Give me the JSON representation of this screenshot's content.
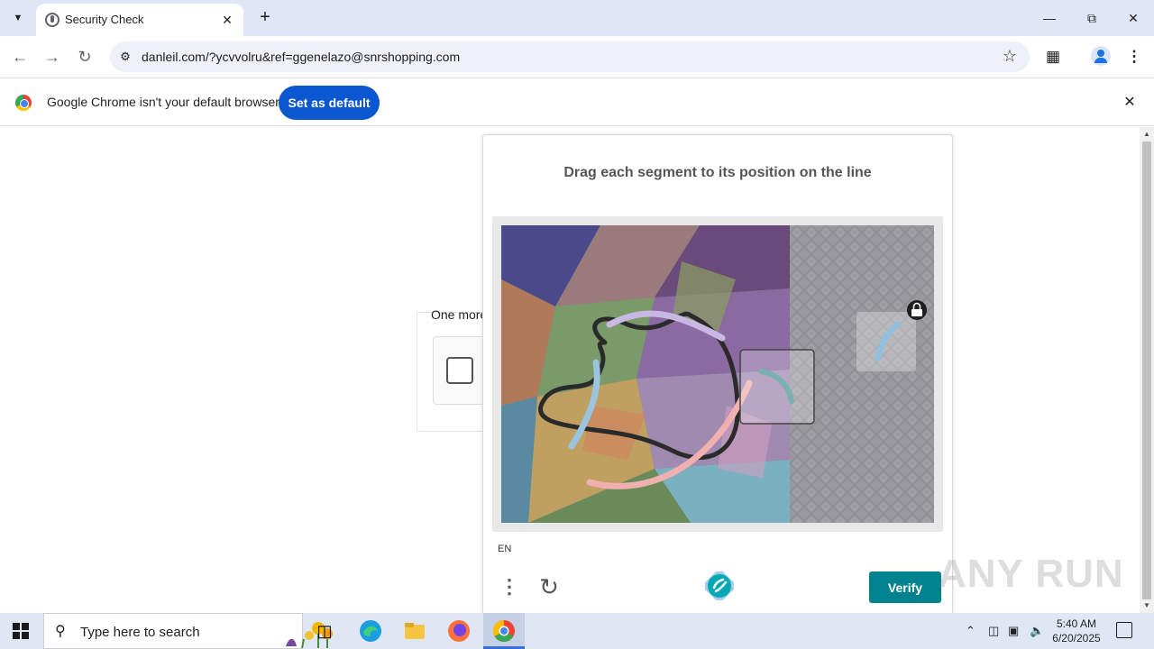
{
  "browser": {
    "tab_title": "Security Check",
    "new_tab_label": "+",
    "url": "danleil.com/?ycvvolru&ref=ggenelazo@snrshopping.com",
    "window_controls": [
      "minimize-icon",
      "restore-icon",
      "close-icon"
    ]
  },
  "infobar": {
    "message": "Google Chrome isn't your default browser",
    "button_label": "Set as default"
  },
  "page": {
    "background_text": "One more"
  },
  "captcha": {
    "title": "Drag each segment to its position on the line",
    "language": "EN",
    "verify_label": "Verify",
    "accent_color": "#00838f"
  },
  "watermark": "ANY RUN",
  "taskbar": {
    "search_placeholder": "Type here to search",
    "time": "5:40 AM",
    "date": "6/20/2025",
    "apps": [
      "task-view-icon",
      "edge-icon",
      "file-explorer-icon",
      "firefox-icon",
      "chrome-icon"
    ]
  }
}
